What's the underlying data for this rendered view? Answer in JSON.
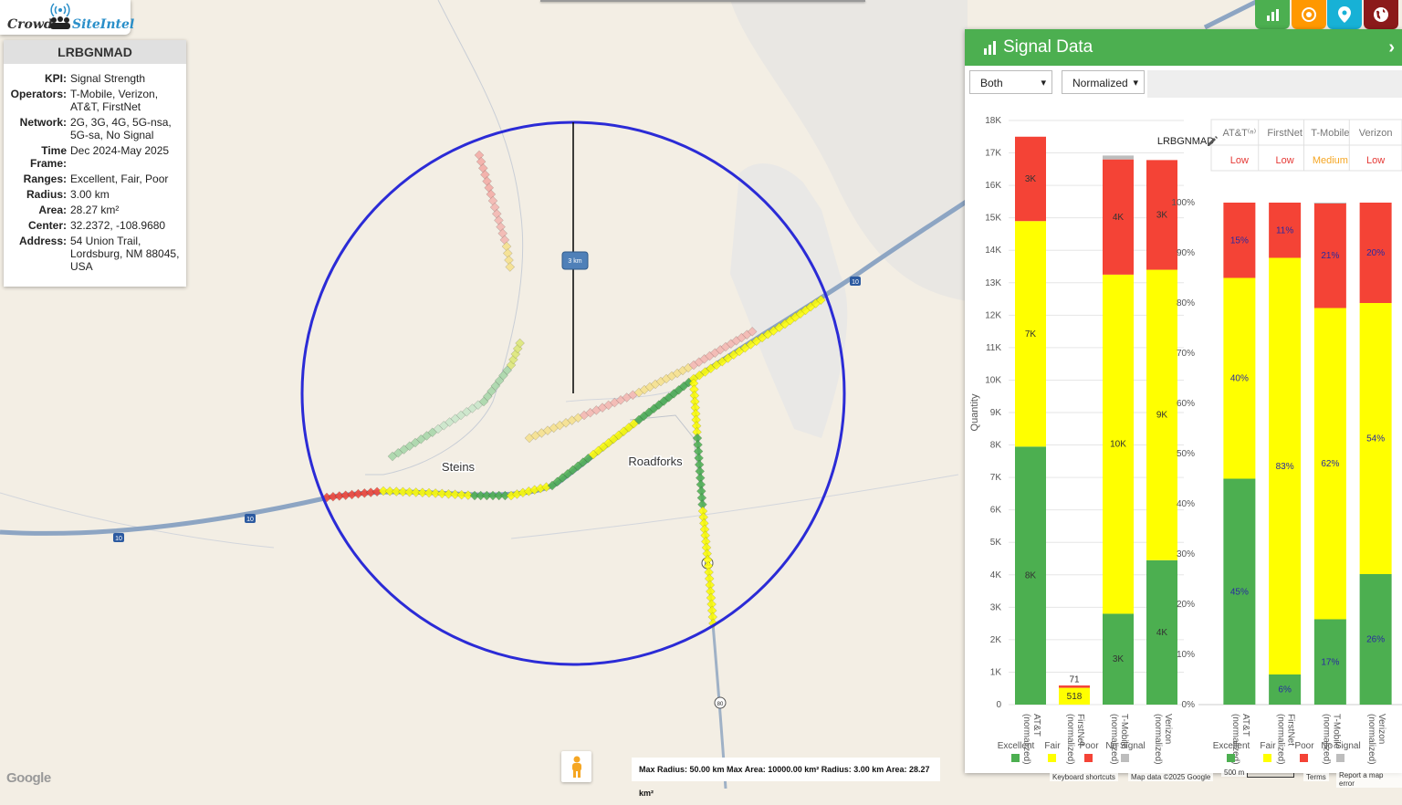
{
  "logo": {
    "part1": "Crowd",
    "part2": "SiteIntel"
  },
  "info": {
    "title": "LRBGNMAD",
    "rows": [
      {
        "k": "KPI:",
        "v": "Signal Strength"
      },
      {
        "k": "Operators:",
        "v": "T-Mobile, Verizon, AT&T, FirstNet"
      },
      {
        "k": "Network:",
        "v": "2G, 3G, 4G, 5G-nsa, 5G-sa, No Signal"
      },
      {
        "k": "Time Frame:",
        "v": "Dec 2024-May 2025"
      },
      {
        "k": "Ranges:",
        "v": "Excellent, Fair, Poor"
      },
      {
        "k": "Radius:",
        "v": "3.00 km"
      },
      {
        "k": "Area:",
        "v": "28.27 km²"
      },
      {
        "k": "Center:",
        "v": "32.2372, -108.9680"
      },
      {
        "k": "Address:",
        "v": "54 Union Trail, Lordsburg, NM 88045, USA"
      }
    ]
  },
  "map": {
    "places": {
      "steins": "Steins",
      "roadforks": "Roadforks"
    },
    "radius_label": "3 km",
    "shields": {
      "i10": "10",
      "us80": "80"
    }
  },
  "top_buttons": [
    {
      "icon": "bar-chart-icon",
      "color": "#4caf50"
    },
    {
      "icon": "target-icon",
      "color": "#ff9800"
    },
    {
      "icon": "map-pin-icon",
      "color": "#17b1d6"
    },
    {
      "icon": "globe-icon",
      "color": "#8b1a1a"
    }
  ],
  "panel": {
    "title": "Signal Data",
    "select1": "Both",
    "select2": "Normalized",
    "chart_title": "LRBGNMAD"
  },
  "colors": {
    "excellent": "#4caf50",
    "fair": "#ffff00",
    "poor": "#f44336",
    "no_signal": "#bdbdbd"
  },
  "legend": [
    "Excellent",
    "Fair",
    "Poor",
    "No Signal"
  ],
  "chart_data": [
    {
      "type": "bar",
      "stacked": true,
      "title": "LRBGNMAD",
      "ylabel": "Quantity",
      "ylim": [
        0,
        18000
      ],
      "yticks": [
        "0",
        "1K",
        "2K",
        "3K",
        "4K",
        "5K",
        "6K",
        "7K",
        "8K",
        "9K",
        "10K",
        "11K",
        "12K",
        "13K",
        "14K",
        "15K",
        "16K",
        "17K",
        "18K"
      ],
      "categories": [
        "AT&T (normalized)",
        "FirstNet (normalized)",
        "T-Mobile (normalized)",
        "Verizon (normalized)"
      ],
      "series": [
        {
          "name": "Excellent",
          "values": [
            7950,
            0,
            2800,
            4450
          ],
          "labels": [
            "8K",
            "",
            "3K",
            "4K"
          ]
        },
        {
          "name": "Fair",
          "values": [
            6950,
            518,
            10450,
            8950
          ],
          "labels": [
            "7K",
            "518",
            "10K",
            "9K"
          ]
        },
        {
          "name": "Poor",
          "values": [
            2600,
            71,
            3550,
            3380
          ],
          "labels": [
            "3K",
            "71",
            "4K",
            "3K"
          ]
        },
        {
          "name": "No Signal",
          "values": [
            0,
            0,
            120,
            0
          ],
          "labels": [
            "",
            "",
            "",
            ""
          ]
        }
      ]
    },
    {
      "type": "bar",
      "stacked": true,
      "ylim": [
        0,
        100
      ],
      "yticks": [
        "0%",
        "10%",
        "20%",
        "30%",
        "40%",
        "50%",
        "60%",
        "70%",
        "80%",
        "90%",
        "100%"
      ],
      "header": [
        "AT&T⁽ⁿ⁾",
        "FirstNet",
        "T-Mobile",
        "Verizon"
      ],
      "ratings": [
        {
          "text": "Low",
          "color": "#e53935"
        },
        {
          "text": "Low",
          "color": "#e53935"
        },
        {
          "text": "Medium",
          "color": "#f5a623"
        },
        {
          "text": "Low",
          "color": "#e53935"
        }
      ],
      "categories": [
        "AT&T (normalized)",
        "FirstNet (normalized)",
        "T-Mobile (normalized)",
        "Verizon (normalized)"
      ],
      "series": [
        {
          "name": "Excellent",
          "values": [
            45,
            6,
            17,
            26
          ],
          "labels": [
            "45%",
            "6%",
            "17%",
            "26%"
          ]
        },
        {
          "name": "Fair",
          "values": [
            40,
            83,
            62,
            54
          ],
          "labels": [
            "40%",
            "83%",
            "62%",
            "54%"
          ]
        },
        {
          "name": "Poor",
          "values": [
            15,
            11,
            21,
            20
          ],
          "labels": [
            "15%",
            "11%",
            "21%",
            "20%"
          ]
        },
        {
          "name": "No Signal",
          "values": [
            0,
            0,
            1,
            0
          ],
          "labels": [
            "",
            "",
            "",
            ""
          ]
        }
      ]
    }
  ],
  "footer": {
    "stats": "Max Radius: 50.00 km Max Area: 10000.00 km² Radius: 3.00 km Area: 28.27 km²",
    "keyboard": "Keyboard shortcuts",
    "mapdata": "Map data ©2025 Google",
    "scale": "500 m",
    "terms": "Terms",
    "report": "Report a map error",
    "google": "Google"
  }
}
